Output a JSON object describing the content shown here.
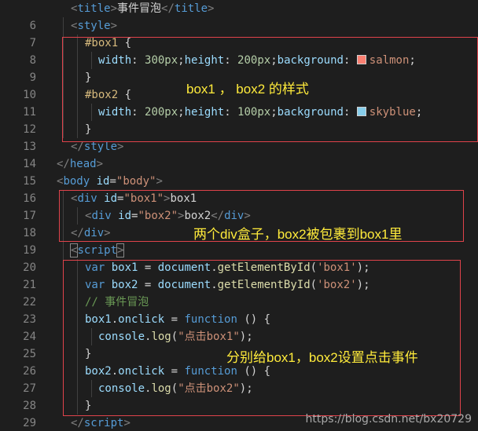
{
  "lines": [
    {
      "n": "6",
      "t": [
        "<",
        "title",
        ">",
        "事件冒泡",
        "</",
        "title",
        ">"
      ]
    },
    {
      "n": "7",
      "t": [
        "<",
        "style",
        ">"
      ]
    },
    {
      "n": "8",
      "t": [
        "#box1",
        " {"
      ]
    },
    {
      "n": "9",
      "t": [
        "width",
        ": ",
        "300px",
        ";",
        "height",
        ": ",
        "200px",
        ";",
        "background",
        ": ",
        "salmon",
        ";"
      ]
    },
    {
      "n": "10",
      "t": [
        "}"
      ]
    },
    {
      "n": "11",
      "t": [
        "#box2",
        " {"
      ]
    },
    {
      "n": "12",
      "t": [
        "width",
        ": ",
        "200px",
        ";",
        "height",
        ": ",
        "100px",
        ";",
        "background",
        ": ",
        "skyblue",
        ";"
      ]
    },
    {
      "n": "13",
      "t": [
        "}"
      ]
    },
    {
      "n": "14",
      "t": [
        "</",
        "style",
        ">"
      ]
    },
    {
      "n": "15",
      "t": [
        "</",
        "head",
        ">"
      ]
    },
    {
      "n": "16",
      "t": [
        "<",
        "body",
        " ",
        "id",
        "=",
        "\"body\"",
        ">"
      ]
    },
    {
      "n": "17",
      "t": [
        "<",
        "div",
        " ",
        "id",
        "=",
        "\"box1\"",
        ">",
        "box1"
      ]
    },
    {
      "n": "18",
      "t": [
        "<",
        "div",
        " ",
        "id",
        "=",
        "\"box2\"",
        ">",
        "box2",
        "</",
        "div",
        ">"
      ]
    },
    {
      "n": "19",
      "t": [
        "</",
        "div",
        ">"
      ]
    },
    {
      "n": "20",
      "t": [
        "<",
        "script",
        ">"
      ]
    },
    {
      "n": "21",
      "t": [
        "var",
        " ",
        "box1",
        " = ",
        "document",
        ".",
        "getElementById",
        "(",
        "'box1'",
        ");"
      ]
    },
    {
      "n": "22",
      "t": [
        "var",
        " ",
        "box2",
        " = ",
        "document",
        ".",
        "getElementById",
        "(",
        "'box2'",
        ");"
      ]
    },
    {
      "n": "23",
      "t": [
        "// 事件冒泡"
      ]
    },
    {
      "n": "24",
      "t": [
        "box1",
        ".",
        "onclick",
        " = ",
        "function",
        " () {"
      ]
    },
    {
      "n": "25",
      "t": [
        "console",
        ".",
        "log",
        "(",
        "\"点击box1\"",
        ");"
      ]
    },
    {
      "n": "26",
      "t": [
        "}"
      ]
    },
    {
      "n": "27",
      "t": [
        "box2",
        ".",
        "onclick",
        " = ",
        "function",
        " () {"
      ]
    },
    {
      "n": "28",
      "t": [
        "console",
        ".",
        "log",
        "(",
        "\"点击box2\"",
        ");"
      ]
    },
    {
      "n": "29",
      "t": [
        "}"
      ]
    },
    {
      "n": "30",
      "t": [
        "</",
        "script",
        ">"
      ]
    }
  ],
  "colors": {
    "salmon": "#fa8072",
    "skyblue": "#87ceeb",
    "annotation": "#ffeb3b",
    "highlight_border": "#e0434b"
  },
  "annotations": {
    "style_note": "box1 ， box2 的样式",
    "div_note": "两个div盒子，box2被包裹到box1里",
    "script_note": "分别给box1，box2设置点击事件"
  },
  "watermark": "https://blog.csdn.net/bx20729"
}
